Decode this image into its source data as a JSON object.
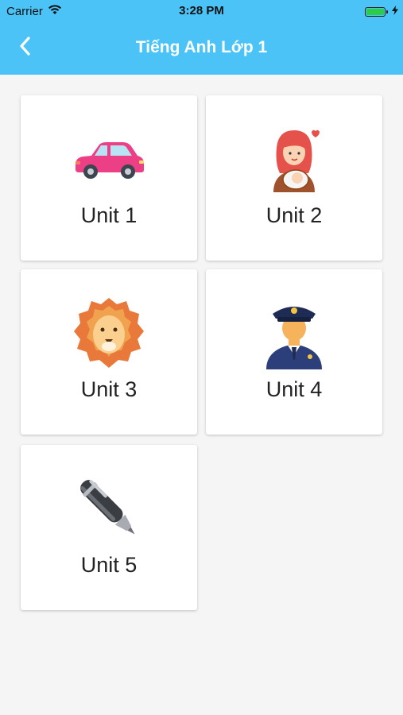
{
  "status_bar": {
    "carrier": "Carrier",
    "time": "3:28 PM",
    "battery_level": 1.0
  },
  "app_bar": {
    "title": "Tiếng Anh Lớp 1",
    "background_color": "#4bc3f7",
    "back_icon": "chevron-left-icon"
  },
  "units": [
    {
      "label": "Unit 1",
      "icon": "car-icon"
    },
    {
      "label": "Unit 2",
      "icon": "mother-baby-icon"
    },
    {
      "label": "Unit 3",
      "icon": "lion-icon"
    },
    {
      "label": "Unit 4",
      "icon": "police-officer-icon"
    },
    {
      "label": "Unit 5",
      "icon": "pen-icon"
    }
  ]
}
